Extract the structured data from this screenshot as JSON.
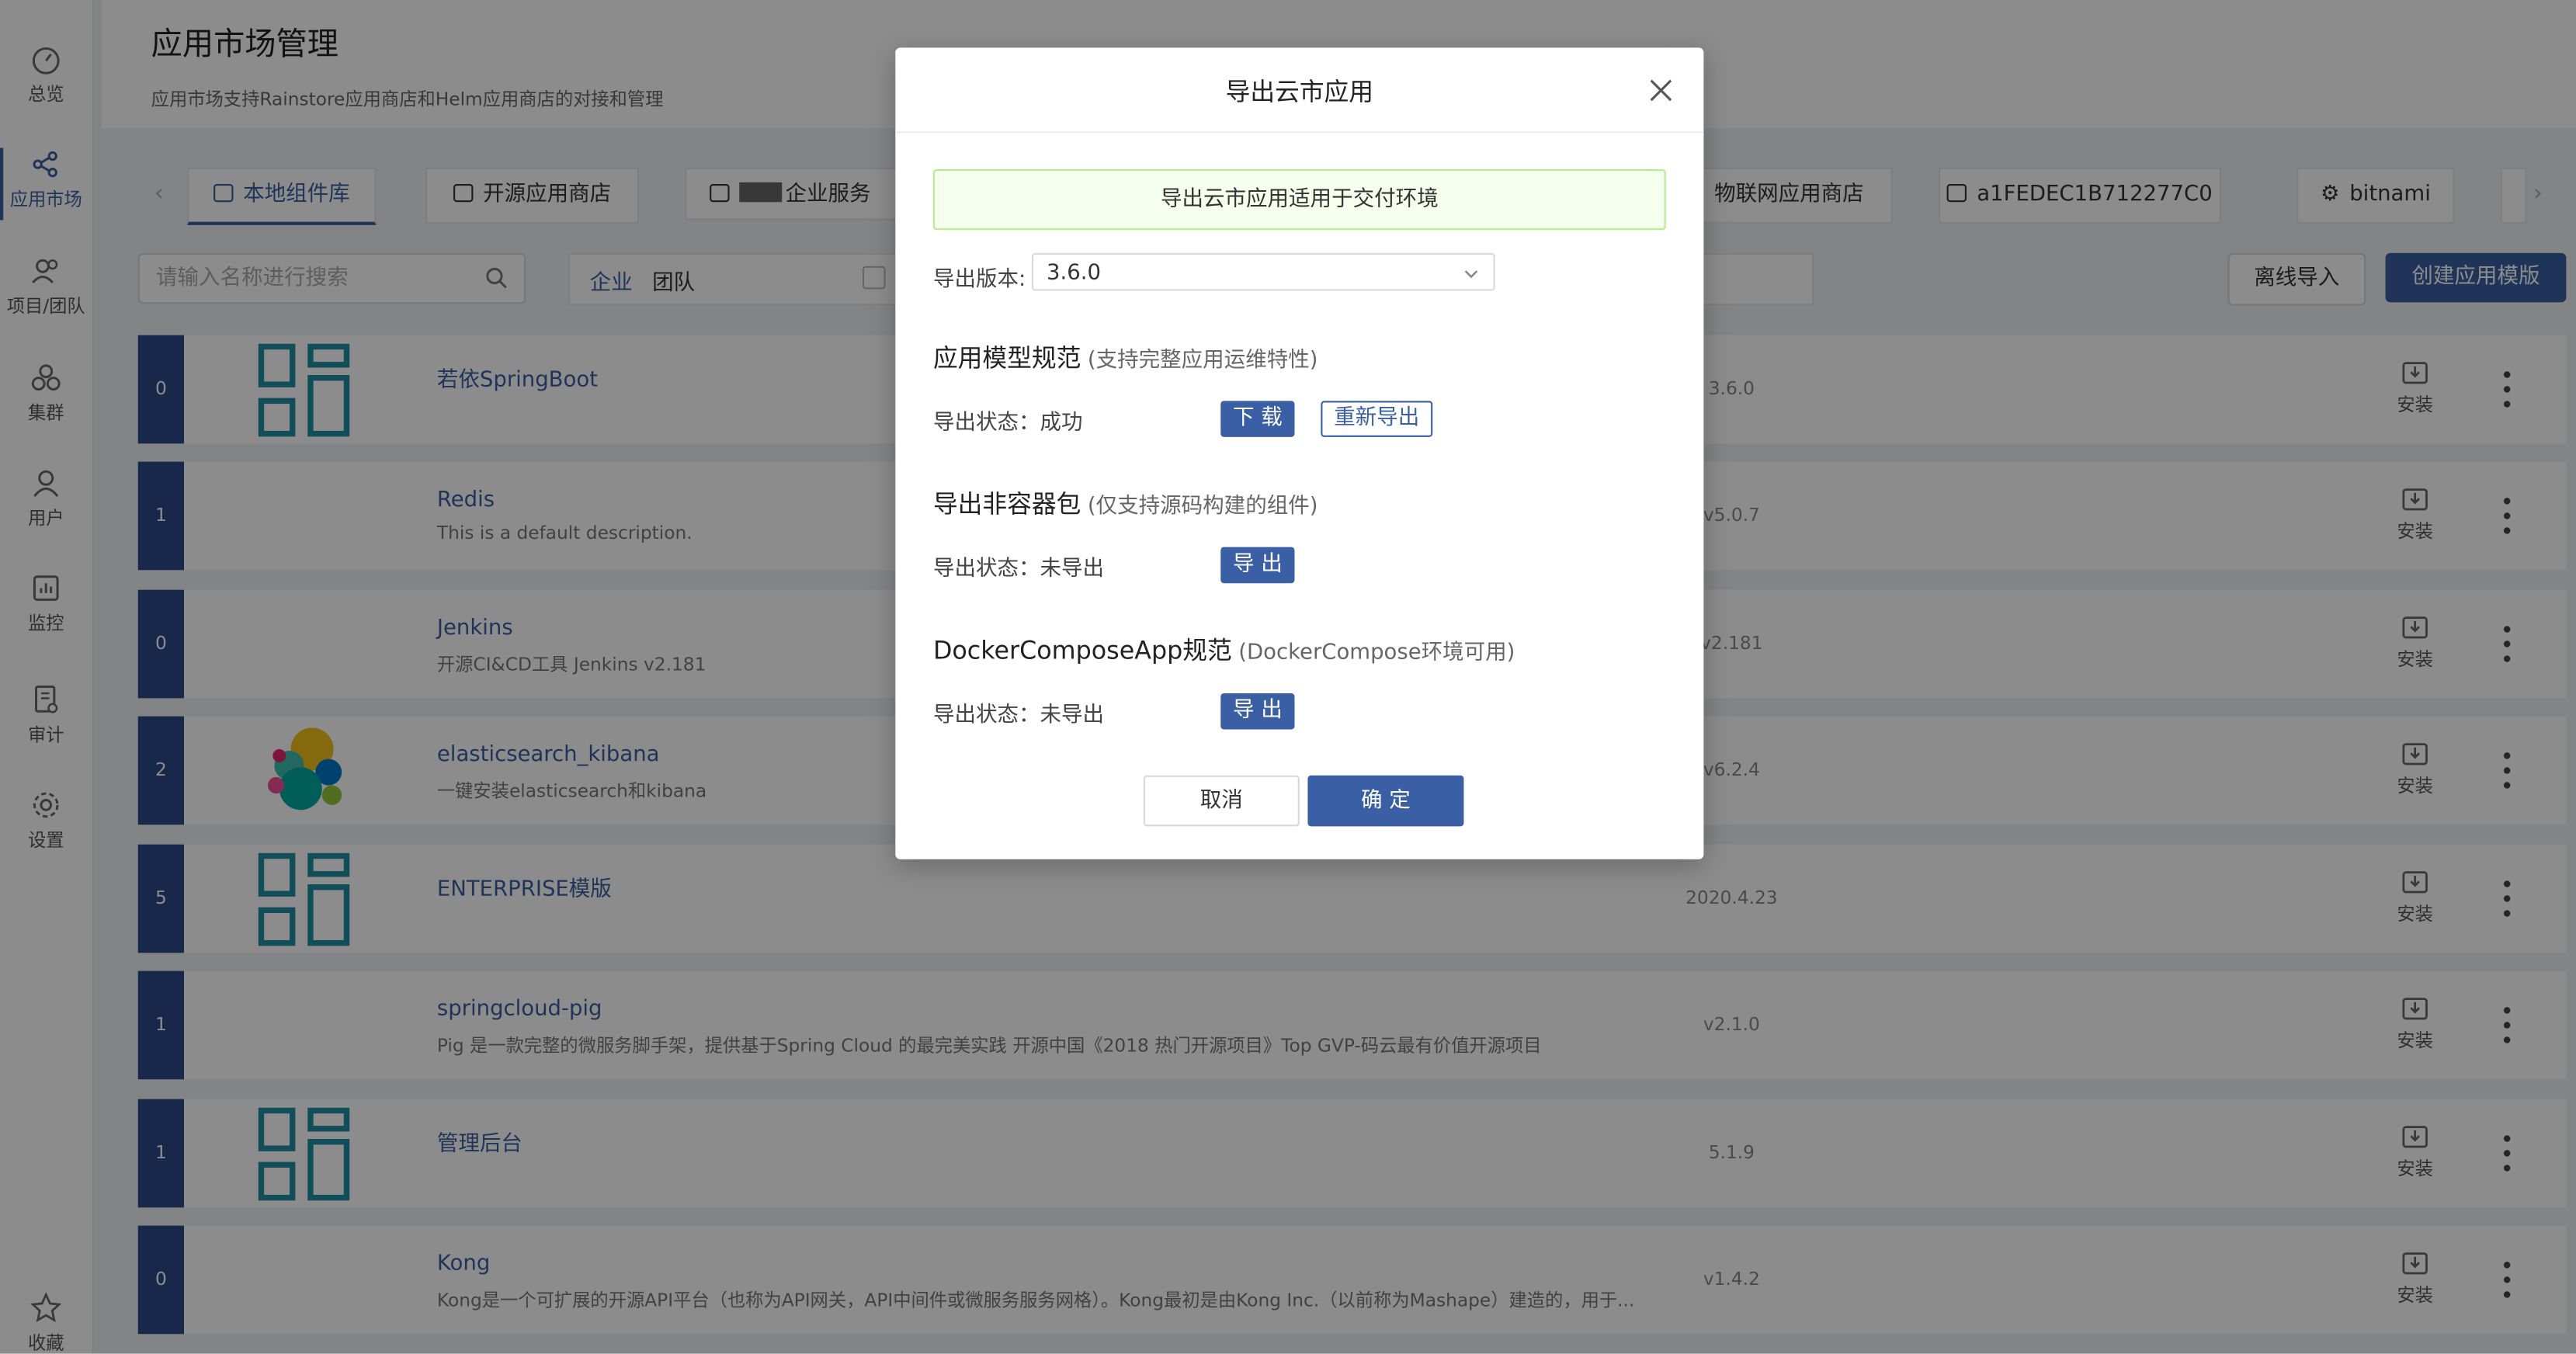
{
  "sidebar": {
    "items": [
      {
        "label": "总览",
        "icon": "dashboard-icon"
      },
      {
        "label": "应用市场",
        "icon": "share-icon"
      },
      {
        "label": "项目/团队",
        "icon": "team-icon"
      },
      {
        "label": "集群",
        "icon": "cluster-icon"
      },
      {
        "label": "用户",
        "icon": "user-icon"
      },
      {
        "label": "监控",
        "icon": "monitor-icon"
      },
      {
        "label": "审计",
        "icon": "audit-icon"
      },
      {
        "label": "设置",
        "icon": "gear-icon"
      },
      {
        "label": "收藏",
        "icon": "star-icon"
      }
    ]
  },
  "header": {
    "title": "应用市场管理",
    "description": "应用市场支持Rainstore应用商店和Helm应用商店的对接和管理"
  },
  "tabs": [
    {
      "label": "本地组件库"
    },
    {
      "label": "开源应用商店"
    },
    {
      "label": "企业服务"
    },
    {
      "label": "物联网应用商店"
    },
    {
      "label": "a1FEDEC1B712277C0"
    },
    {
      "label": "bitnami"
    }
  ],
  "toolbar": {
    "search_placeholder": "请输入名称进行搜索",
    "seg_enterprise": "企业",
    "seg_team": "团队",
    "offline_import": "离线导入",
    "create_template": "创建应用模版"
  },
  "apps": [
    {
      "count": "0",
      "name": "若依SpringBoot",
      "desc": "",
      "version": "3.6.0",
      "logo": "grid-logo"
    },
    {
      "count": "1",
      "name": "Redis",
      "desc": "This is a default description.",
      "version": "v5.0.7",
      "logo": ""
    },
    {
      "count": "0",
      "name": "Jenkins",
      "desc": "开源CI&CD工具 Jenkins v2.181",
      "version": "v2.181",
      "logo": ""
    },
    {
      "count": "2",
      "name": "elasticsearch_kibana",
      "desc": "一键安装elasticsearch和kibana",
      "version": "v6.2.4",
      "logo": "elastic-logo"
    },
    {
      "count": "5",
      "name": "ENTERPRISE模版",
      "desc": "",
      "version": "2020.4.23",
      "logo": "grid-logo"
    },
    {
      "count": "1",
      "name": "springcloud-pig",
      "desc": "Pig 是一款完整的微服务脚手架，提供基于Spring Cloud 的最完美实践 开源中国《2018 热门开源项目》Top GVP-码云最有价值开源项目",
      "version": "v2.1.0",
      "logo": ""
    },
    {
      "count": "1",
      "name": "管理后台",
      "desc": "",
      "version": "5.1.9",
      "logo": "grid-logo"
    },
    {
      "count": "0",
      "name": "Kong",
      "desc": "Kong是一个可扩展的开源API平台（也称为API网关，API中间件或微服务服务网格）。Kong最初是由Kong Inc.（以前称为Mashape）建造的，用于...",
      "version": "v1.4.2",
      "logo": ""
    }
  ],
  "install_label": "安装",
  "modal": {
    "title": "导出云市应用",
    "alert": "导出云市应用适用于交付环境",
    "version_label": "导出版本:",
    "version_value": "3.6.0",
    "sections": [
      {
        "title": "应用模型规范",
        "subtitle": "(支持完整应用运维特性)",
        "status": "导出状态：成功",
        "primary": "下 载",
        "secondary": "重新导出"
      },
      {
        "title": "导出非容器包",
        "subtitle": "(仅支持源码构建的组件)",
        "status": "导出状态：未导出",
        "primary": "导 出"
      },
      {
        "title": "DockerComposeApp规范",
        "subtitle": "(DockerCompose环境可用)",
        "status": "导出状态：未导出",
        "primary": "导 出"
      }
    ],
    "cancel": "取消",
    "ok": "确 定"
  },
  "colors": {
    "primary": "#3b5fa5",
    "badge": "#2c4a87",
    "success_bg": "#f6ffed",
    "success_border": "#b7eb8f",
    "logo_teal": "#1f8ea3"
  }
}
